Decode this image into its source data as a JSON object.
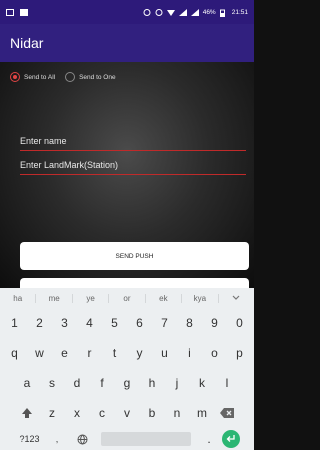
{
  "status": {
    "battery": "46%",
    "time": "21:51"
  },
  "app": {
    "title": "Nidar"
  },
  "radios": {
    "all": "Send to All",
    "one": "Send to One"
  },
  "fields": {
    "name": "Enter name",
    "landmark": "Enter LandMark(Station)"
  },
  "buttons": {
    "send": "SEND PUSH"
  },
  "keyboard": {
    "suggestions": [
      "ha",
      "me",
      "ye",
      "or",
      "ek",
      "kya"
    ],
    "row1": [
      "1",
      "2",
      "3",
      "4",
      "5",
      "6",
      "7",
      "8",
      "9",
      "0"
    ],
    "row2": [
      "q",
      "w",
      "e",
      "r",
      "t",
      "y",
      "u",
      "i",
      "o",
      "p"
    ],
    "row3": [
      "a",
      "s",
      "d",
      "f",
      "g",
      "h",
      "j",
      "k",
      "l"
    ],
    "row4": [
      "z",
      "x",
      "c",
      "v",
      "b",
      "n",
      "m"
    ],
    "mode": "?123",
    "comma": ",",
    "period": "."
  }
}
